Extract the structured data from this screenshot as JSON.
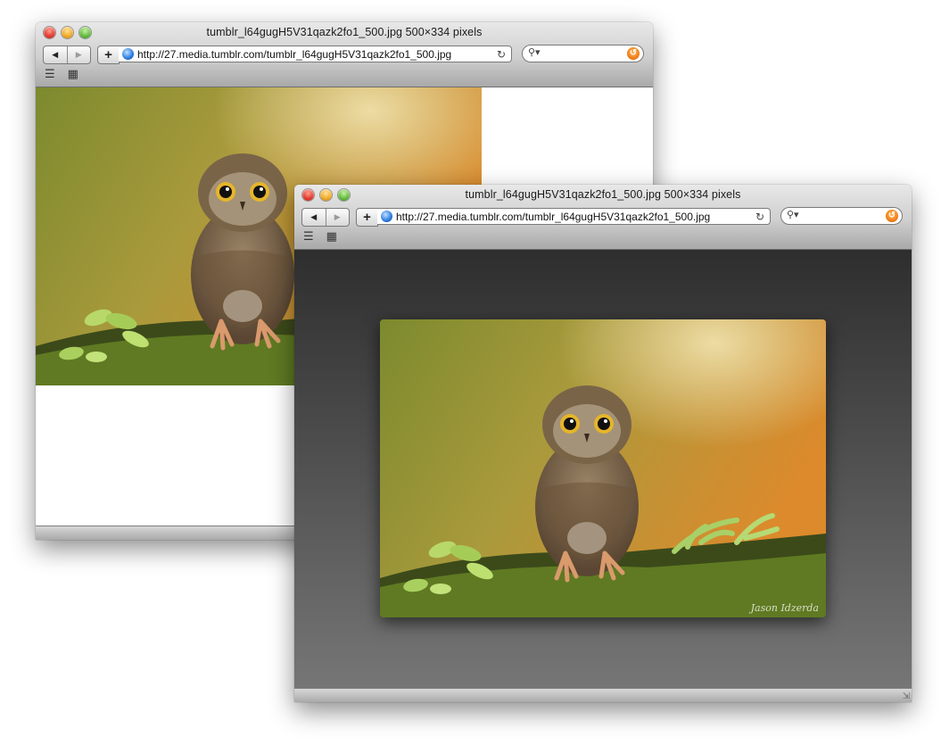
{
  "windows": [
    {
      "id": "back",
      "title": "tumblr_l64gugH5V31qazk2fo1_500.jpg 500×334 pixels",
      "url": "http://27.media.tumblr.com/tumblr_l64gugH5V31qazk2fo1_500.jpg",
      "search_value": ""
    },
    {
      "id": "front",
      "title": "tumblr_l64gugH5V31qazk2fo1_500.jpg 500×334 pixels",
      "url": "http://27.media.tumblr.com/tumblr_l64gugH5V31qazk2fo1_500.jpg",
      "search_value": ""
    }
  ],
  "toolbar": {
    "back_glyph": "◀",
    "forward_glyph": "▶",
    "add_glyph": "+",
    "reload_glyph": "↻",
    "search_glyph": "🔍︎",
    "snapback_glyph": "↺",
    "bookmarks_glyph": "📖︎",
    "topsites_glyph": "▦"
  },
  "image": {
    "watermark": "Jason Idzerda"
  },
  "colors": {
    "photo_bg_warm": "#d98a2b",
    "photo_bg_green": "#8a9a3a",
    "viewer_bg_top": "#2e2e2e",
    "viewer_bg_bottom": "#767676"
  },
  "icons": [
    "globe-icon",
    "reload-icon",
    "search-icon",
    "snapback-icon",
    "bookmarks-icon",
    "top-sites-icon"
  ]
}
